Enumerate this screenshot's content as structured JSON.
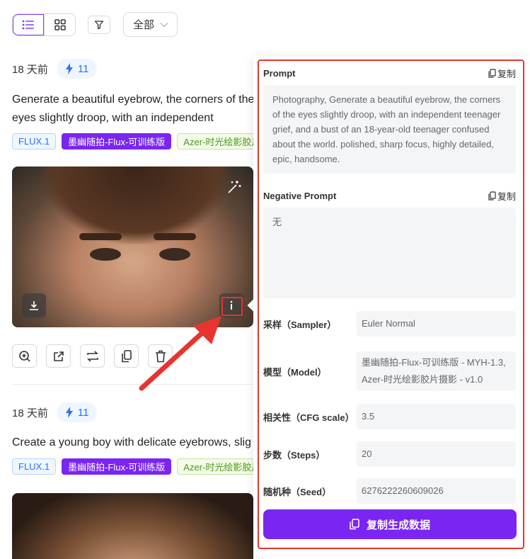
{
  "toolbar": {
    "filter_select": "全部"
  },
  "card1": {
    "time_ago": "18 天前",
    "credits": "11",
    "prompt": "Generate a beautiful eyebrow, the corners of the eyes slightly droop, with an independent teenager grief, and a bust of an 18-year-old teenager confused about the world. polished, sharp focus, highly detailed, epic, handsome.,",
    "tags": [
      "FLUX.1",
      "墨幽随拍-Flux-可训练版",
      "Azer-时光绘影胶片摄影"
    ]
  },
  "card2": {
    "time_ago": "18 天前",
    "credits": "11",
    "prompt": "Create a young boy with delicate eyebrows, slig",
    "tags": [
      "FLUX.1",
      "墨幽随拍-Flux-可训练版",
      "Azer-时光绘影胶片摄影"
    ]
  },
  "popup": {
    "prompt_label": "Prompt",
    "copy_label": "复制",
    "prompt_text": "Photography, Generate a beautiful eyebrow, the corners of the eyes slightly droop, with an independent teenager grief, and a bust of an 18-year-old teenager confused about the world. polished, sharp focus, highly detailed, epic, handsome.",
    "negative_label": "Negative Prompt",
    "negative_text": "无",
    "sampler_label": "采样（Sampler）",
    "sampler_value": "Euler Normal",
    "model_label": "模型（Model）",
    "model_value": "墨幽随拍-Flux-可训练版 - MYH-1.3, Azer-时光绘影胶片摄影 - v1.0",
    "cfg_label": "相关性（CFG scale）",
    "cfg_value": "3.5",
    "steps_label": "步数（Steps）",
    "steps_value": "20",
    "seed_label": "随机种（Seed）",
    "seed_value": "6276222260609026",
    "cta_label": "复制生成数据"
  },
  "colors": {
    "accent": "#7a25f1",
    "highlight": "#e8342f"
  }
}
